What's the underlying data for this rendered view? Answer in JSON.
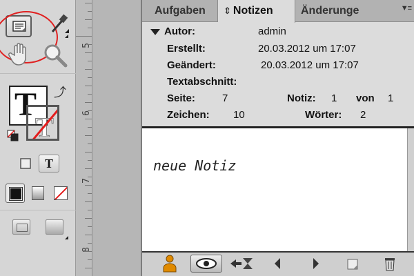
{
  "ruler": {
    "numbers": [
      "5",
      "6",
      "7",
      "8"
    ]
  },
  "panel": {
    "tabs": {
      "aufgaben": "Aufgaben",
      "notizen": "Notizen",
      "aenderungen": "Änderunge"
    },
    "info": {
      "author_label": "Autor:",
      "author_value": "admin",
      "created_label": "Erstellt:",
      "created_value": "20.03.2012 um 17:07",
      "modified_label": "Geändert:",
      "modified_value": "20.03.2012 um 17:07",
      "story_label": "Textabschnitt:",
      "page_label": "Seite:",
      "page_value": "7",
      "note_label": "Notiz:",
      "note_value": "1",
      "of_label": "von",
      "of_value": "1",
      "chars_label": "Zeichen:",
      "chars_value": "10",
      "words_label": "Wörter:",
      "words_value": "2"
    },
    "note_text": "neue Notiz"
  },
  "colors": {
    "highlight_circle": "#e02020",
    "none_swatch_slash": "#e41c1c",
    "user_icon": "#e08a00"
  },
  "icons": {
    "note_tool": "note-icon",
    "eyedropper": "eyedropper-icon",
    "hand": "hand-icon",
    "zoom": "magnifier-icon",
    "swap": "swap-arrow-icon",
    "user": "user-icon",
    "show_hide": "eye-icon",
    "go_to_anchor": "arrow-to-anchor-icon",
    "previous": "triangle-left-icon",
    "next": "triangle-right-icon",
    "new_note": "new-note-icon",
    "delete": "trash-icon"
  }
}
